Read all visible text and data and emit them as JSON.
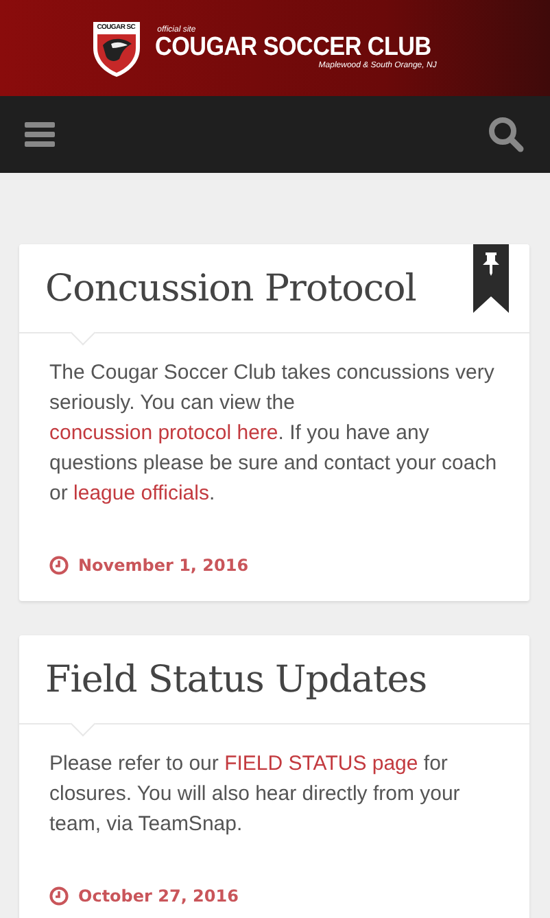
{
  "header": {
    "badge_text": "COUGAR SC",
    "tagline": "official site",
    "site_name": "COUGAR SOCCER CLUB",
    "location": "Maplewood & South Orange, NJ"
  },
  "posts": [
    {
      "title": "Concussion Protocol",
      "pinned": true,
      "body": [
        {
          "kind": "text",
          "text": "The Cougar Soccer Club takes concussions very seriously.  You can view the "
        },
        {
          "kind": "link",
          "text": "concussion protocol here"
        },
        {
          "kind": "text",
          "text": ".  If you have any questions please be sure and contact your coach or "
        },
        {
          "kind": "link",
          "text": "league officials"
        },
        {
          "kind": "text",
          "text": "."
        }
      ],
      "date": "November 1, 2016"
    },
    {
      "title": "Field Status Updates",
      "pinned": false,
      "body": [
        {
          "kind": "text",
          "text": "Please refer to our "
        },
        {
          "kind": "link",
          "text": "FIELD STATUS page"
        },
        {
          "kind": "text",
          "text": " for closures.  You will also hear directly from your team, via TeamSnap."
        }
      ],
      "date": "October 27, 2016"
    }
  ]
}
